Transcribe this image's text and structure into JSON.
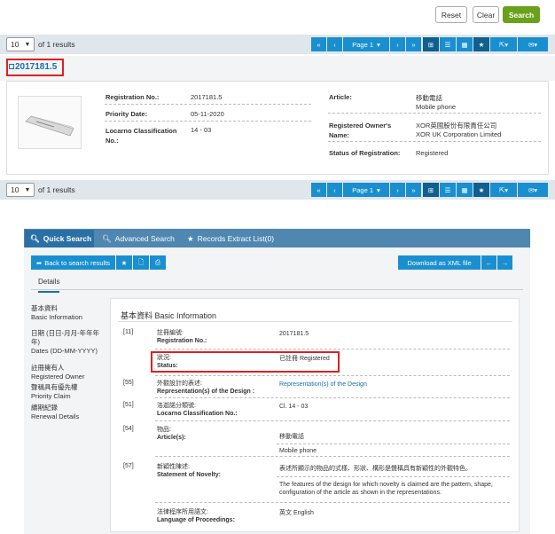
{
  "toolbar": {
    "reset": "Reset",
    "clear": "Clear",
    "search": "Search"
  },
  "results_bar": {
    "page_size": "10",
    "of_results": "of 1 results",
    "page_label": "Page 1"
  },
  "result": {
    "id": "2017181.5",
    "fields_left": [
      {
        "label": "Registration No.:",
        "value": "2017181.5"
      },
      {
        "label": "Priority Date:",
        "value": "05-11-2020"
      },
      {
        "label": "Locarno Classification No.:",
        "value": "14 - 03"
      }
    ],
    "article_label": "Article:",
    "article_value_zh": "移動電話",
    "article_value_en": "Mobile phone",
    "owner_label": "Registered Owner's Name:",
    "owner_value_zh": "XOR英國股份有限責任公司",
    "owner_value_en": "XOR UK Corporation Limited",
    "status_label": "Status of Registration:",
    "status_value": "Registered"
  },
  "tabs": {
    "quick": "Quick Search",
    "advanced": "Advanced Search",
    "records": "Records Extract List(0)"
  },
  "detail_toolbar": {
    "back": "Back to search results",
    "download": "Download as XML file"
  },
  "details_tab": "Details",
  "sidebar": [
    {
      "zh": "基本資料",
      "en": "Basic Information"
    },
    {
      "zh": "日期 (日日-月月-年年年年)",
      "en": "Dates (DD-MM-YYYY)"
    },
    {
      "zh": "註冊擁有人",
      "en": "Registered Owner"
    },
    {
      "zh": "聲稱具有優先權",
      "en": "Priority Claim"
    },
    {
      "zh": "續期紀錄",
      "en": "Renewal Details"
    }
  ],
  "section_title": "基本資料 Basic Information",
  "detail_rows": [
    {
      "code": "[11]",
      "label_zh": "註冊編號:",
      "label_en": "Registration No.:",
      "value": "2017181.5"
    },
    {
      "code": "",
      "label_zh": "狀況:",
      "label_en": "Status:",
      "value": "已註冊 Registered"
    },
    {
      "code": "[55]",
      "label_zh": "外觀設計的表述:",
      "label_en": "Representation(s) of the Design :",
      "value": "Representation(s) of the Design"
    },
    {
      "code": "[51]",
      "label_zh": "洛迦諾分類號:",
      "label_en": "Locarno Classification No.:",
      "value": "Cl. 14 - 03"
    },
    {
      "code": "[54]",
      "label_zh": "物品:",
      "label_en": "Article(s):",
      "value_zh": "移動電話",
      "value_en": "Mobile phone"
    },
    {
      "code": "[57]",
      "label_zh": "新穎性陳述:",
      "label_en": "Statement of Novelty:",
      "value_zh": "表述所顯示的物品的式樣、形狀、構形是聲稱具有新穎性的外觀特色。",
      "value_en": "The features of the design for which novelty is claimed are the pattern, shape, configuration of the article as shown in the representations."
    },
    {
      "code": "",
      "label_zh": "法律程序所用語文:",
      "label_en": "Language of Proceedings:",
      "value": "英文 English"
    }
  ],
  "colors": {
    "accent": "#1a8fd0",
    "green": "#6aa11b",
    "highlight": "#e02020",
    "tab_bar": "#4f87b0"
  }
}
